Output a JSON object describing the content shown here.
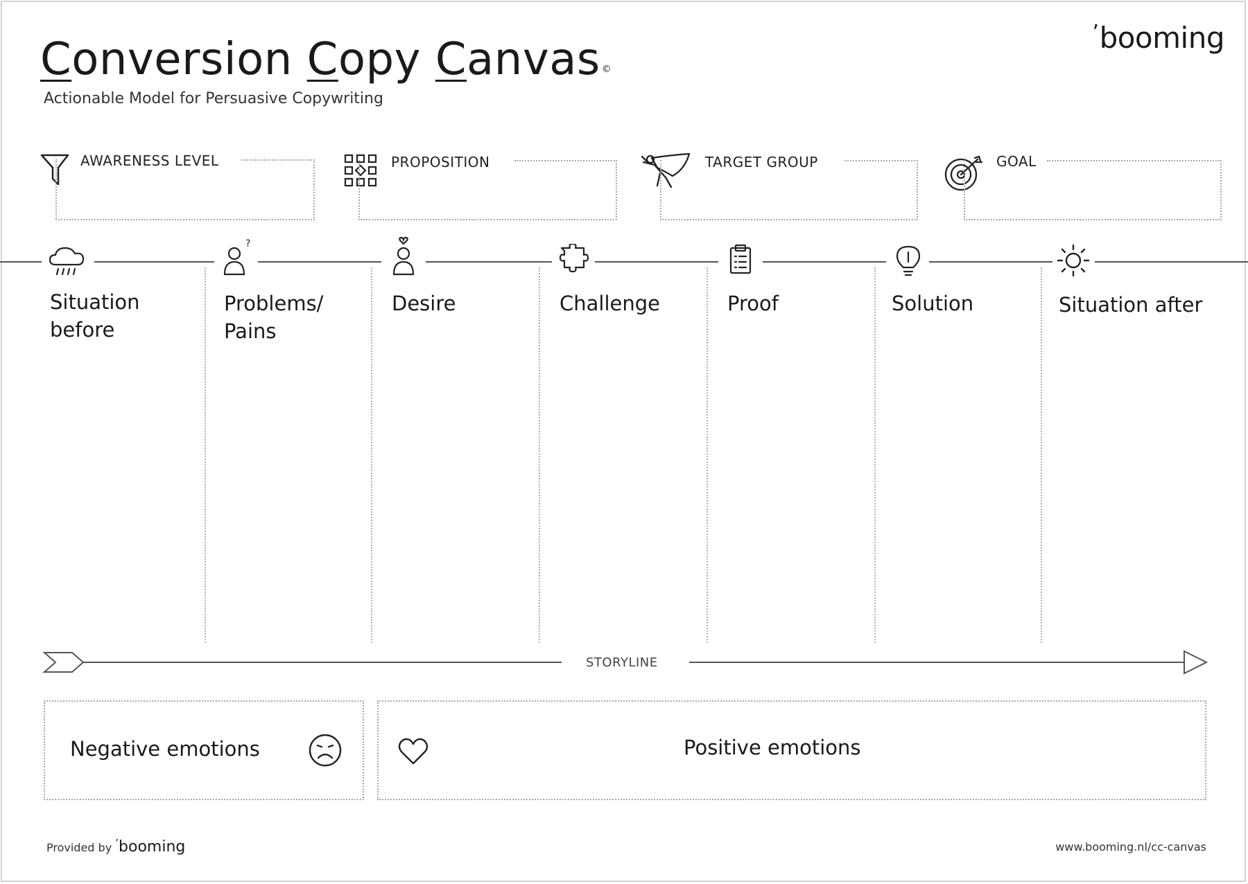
{
  "header": {
    "title_parts": [
      {
        "first": "C",
        "rest": "onversion"
      },
      {
        "first": "C",
        "rest": "opy"
      },
      {
        "first": "C",
        "rest": "anvas"
      }
    ],
    "copyright_mark": "©",
    "subtitle": "Actionable Model for Persuasive Copywriting",
    "brand": "booming"
  },
  "fields": [
    {
      "label": "AWARENESS LEVEL",
      "icon": "funnel-icon"
    },
    {
      "label": "PROPOSITION",
      "icon": "grid-diamond-icon"
    },
    {
      "label": "TARGET GROUP",
      "icon": "flying-hero-icon"
    },
    {
      "label": "GOAL",
      "icon": "target-icon"
    }
  ],
  "columns": [
    {
      "label": "Situation before",
      "icon": "rain-cloud-icon"
    },
    {
      "label": "Problems/ Pains",
      "icon": "person-question-icon"
    },
    {
      "label": "Desire",
      "icon": "person-heart-icon"
    },
    {
      "label": "Challenge",
      "icon": "puzzle-piece-icon"
    },
    {
      "label": "Proof",
      "icon": "clipboard-list-icon"
    },
    {
      "label": "Solution",
      "icon": "lightbulb-icon"
    },
    {
      "label": "Situation after",
      "icon": "sun-icon"
    }
  ],
  "storyline": {
    "label": "STORYLINE"
  },
  "emotions": {
    "negative": {
      "label": "Negative emotions",
      "icon": "sad-face-icon"
    },
    "positive": {
      "label": "Positive emotions",
      "icon": "heart-icon"
    }
  },
  "footer": {
    "provided_by": "Provided by",
    "brand": "booming",
    "url": "www.booming.nl/cc-canvas"
  }
}
